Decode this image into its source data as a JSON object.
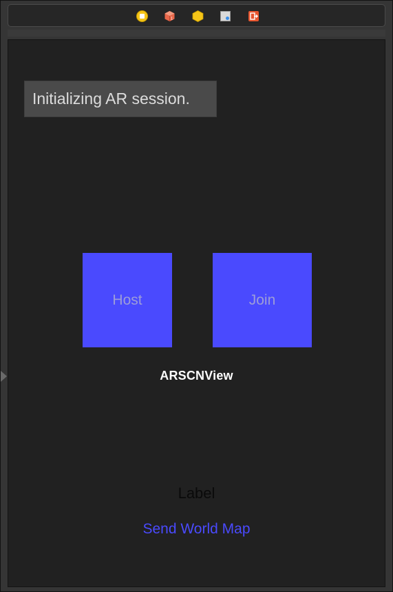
{
  "scene_dock": {
    "icons": [
      "view-controller-icon",
      "first-responder-icon",
      "object-icon",
      "storyboard-reference-icon",
      "exit-icon"
    ]
  },
  "status_label": {
    "text": "Initializing AR session."
  },
  "buttons": {
    "host_label": "Host",
    "join_label": "Join",
    "send_world_map_label": "Send World Map"
  },
  "view_name": "ARSCNView",
  "label": {
    "text": "Label"
  },
  "colors": {
    "button_fill": "#4a4afe",
    "button_text": "#9d9dd8",
    "link_blue": "#4a4afe",
    "canvas": "#212121"
  }
}
